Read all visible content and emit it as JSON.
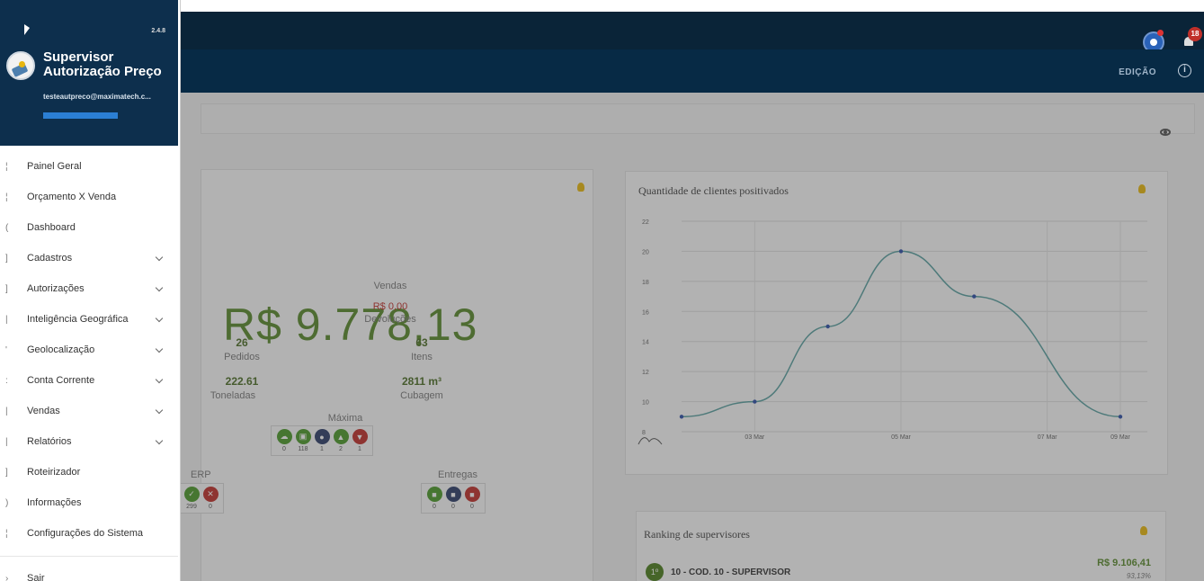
{
  "header": {
    "edit_label": "EDIÇÃO",
    "info_icon": "i",
    "notification_count": "18"
  },
  "sidebar": {
    "version": "2.4.8",
    "title": "Supervisor Autorização Preço",
    "email": "testeautpreco@maximatech.c...",
    "items": [
      {
        "label": "Painel Geral",
        "glyph": "¦",
        "expandable": false
      },
      {
        "label": "Orçamento X Venda",
        "glyph": "¦",
        "expandable": false
      },
      {
        "label": "Dashboard",
        "glyph": "(",
        "expandable": false
      },
      {
        "label": "Cadastros",
        "glyph": "]",
        "expandable": true
      },
      {
        "label": "Autorizações",
        "glyph": "]",
        "expandable": true
      },
      {
        "label": "Inteligência Geográfica",
        "glyph": "|",
        "expandable": true
      },
      {
        "label": "Geolocalização",
        "glyph": "'",
        "expandable": true
      },
      {
        "label": "Conta Corrente",
        "glyph": ":",
        "expandable": true
      },
      {
        "label": "Vendas",
        "glyph": "|",
        "expandable": true
      },
      {
        "label": "Relatórios",
        "glyph": "|",
        "expandable": true
      },
      {
        "label": "Roteirizador",
        "glyph": "]",
        "expandable": false
      },
      {
        "label": "Informações",
        "glyph": ")",
        "expandable": false
      },
      {
        "label": "Configurações do Sistema",
        "glyph": "¦",
        "expandable": false
      }
    ],
    "exit": {
      "label": "Sair",
      "glyph": "›"
    }
  },
  "sales_card": {
    "total": "R$ 9.778,13",
    "sales_label": "Vendas",
    "returns_value": "R$ 0,00",
    "returns_label": "Devoluções",
    "orders_value": "26",
    "orders_label": "Pedidos",
    "items_value": "63",
    "items_label": "Itens",
    "tons_value": "222.61",
    "tons_label": "Toneladas",
    "volume_value": "2811 m³",
    "volume_label": "Cubagem",
    "maxima_label": "Máxima",
    "maxima_counts": [
      "0",
      "118",
      "1",
      "2",
      "1"
    ],
    "erp_label": "ERP",
    "erp_counts": [
      "299",
      "0"
    ],
    "delivery_label": "Entregas",
    "delivery_counts": [
      "0",
      "0",
      "0"
    ]
  },
  "chart_data": {
    "type": "line",
    "title": "Quantidade de clientes positivados",
    "x": [
      "02 Mar",
      "03 Mar",
      "04 Mar",
      "05 Mar",
      "06 Mar",
      "07 Mar",
      "09 Mar"
    ],
    "x_tick_labels": [
      "03 Mar",
      "05 Mar",
      "07 Mar",
      "09 Mar"
    ],
    "values": [
      9,
      10,
      15,
      20,
      17,
      null,
      9
    ],
    "ylim": [
      8,
      22
    ],
    "y_ticks": [
      8,
      10,
      12,
      14,
      16,
      18,
      20,
      22
    ],
    "grid": true,
    "color": "#5aa0a0"
  },
  "ranking": {
    "title": "Ranking de supervisores",
    "entries": [
      {
        "position": "1º",
        "name": "10 - COD. 10 - SUPERVISOR",
        "value": "R$ 9.106,41",
        "percent": "93,13%"
      }
    ]
  }
}
